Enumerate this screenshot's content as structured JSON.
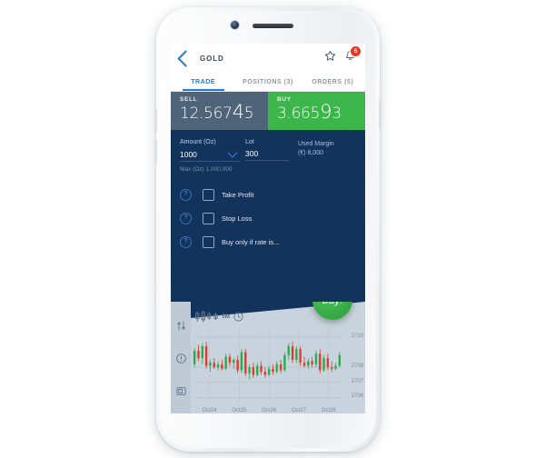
{
  "header": {
    "symbol": "GOLD",
    "back_icon": "back-chevron-icon",
    "star_icon": "star-outline-icon",
    "bell_icon": "bell-icon",
    "badge_count": "5"
  },
  "tabs": [
    {
      "label": "TRADE",
      "active": true
    },
    {
      "label": "POSITIONS (3)",
      "active": false
    },
    {
      "label": "ORDERS (5)",
      "active": false
    }
  ],
  "prices": {
    "sell": {
      "label": "SELL",
      "small_prefix": "12.567",
      "big_digits": "4",
      "small_suffix": "5",
      "color": "#4f6379"
    },
    "buy": {
      "label": "BUY",
      "small_prefix": "3.665",
      "big_digits": "9",
      "small_suffix": "3",
      "color": "#3cb54a"
    }
  },
  "form": {
    "amount_label": "Amount (Oz)",
    "amount_value": "1000",
    "lot_label": "Lot",
    "lot_value": "300",
    "margin_label": "Used Margin",
    "margin_value": "(€) 8,000",
    "max_note": "Max (Oz) 1,000,000",
    "options": [
      {
        "label": "Take Profit",
        "checked": false,
        "help": "?"
      },
      {
        "label": "Stop Loss",
        "checked": false,
        "help": "?"
      },
      {
        "label": "Buy only if rate is...",
        "checked": false,
        "help": "?"
      }
    ]
  },
  "buy_button": {
    "label": "buy!",
    "color": "#3aaf49"
  },
  "chart": {
    "timeframe": "5M",
    "rail_icons": [
      "swap-vertical-icon",
      "info-circle-icon",
      "report-icon"
    ],
    "type_icon": "candlestick-icon",
    "clock_icon": "clock-icon"
  },
  "chart_data": {
    "type": "bar",
    "chart_style": "candlestick",
    "title": "",
    "xlabel": "",
    "ylabel": "",
    "categories": [
      "Oct24",
      "Oct25",
      "Oct26",
      "Oct27",
      "Oct28"
    ],
    "x_tick_labels": [
      "Oct24",
      "Oct25",
      "Oct26",
      "Oct27",
      "Oct28"
    ],
    "y_tick_labels": [
      "2710",
      "2708",
      "2707",
      "2706"
    ],
    "ylim": [
      2705.6,
      2710.6
    ],
    "grid": true,
    "up_color": "#27ae4a",
    "down_color": "#e03a2f",
    "candles": [
      {
        "o": 2708.2,
        "h": 2709.3,
        "l": 2708.0,
        "c": 2709.1,
        "dir": "up"
      },
      {
        "o": 2709.1,
        "h": 2709.5,
        "l": 2708.4,
        "c": 2708.6,
        "dir": "down"
      },
      {
        "o": 2708.6,
        "h": 2709.6,
        "l": 2708.2,
        "c": 2709.4,
        "dir": "up"
      },
      {
        "o": 2709.4,
        "h": 2709.7,
        "l": 2707.9,
        "c": 2708.1,
        "dir": "down"
      },
      {
        "o": 2708.1,
        "h": 2708.5,
        "l": 2707.7,
        "c": 2708.3,
        "dir": "up"
      },
      {
        "o": 2708.3,
        "h": 2708.6,
        "l": 2707.9,
        "c": 2708.0,
        "dir": "down"
      },
      {
        "o": 2708.0,
        "h": 2708.4,
        "l": 2707.8,
        "c": 2708.2,
        "dir": "up"
      },
      {
        "o": 2708.2,
        "h": 2708.5,
        "l": 2707.8,
        "c": 2707.9,
        "dir": "down"
      },
      {
        "o": 2707.9,
        "h": 2708.9,
        "l": 2707.8,
        "c": 2708.7,
        "dir": "up"
      },
      {
        "o": 2708.7,
        "h": 2708.9,
        "l": 2708.1,
        "c": 2708.3,
        "dir": "down"
      },
      {
        "o": 2708.3,
        "h": 2708.6,
        "l": 2707.9,
        "c": 2708.5,
        "dir": "up"
      },
      {
        "o": 2708.5,
        "h": 2708.8,
        "l": 2707.6,
        "c": 2707.8,
        "dir": "down"
      },
      {
        "o": 2707.8,
        "h": 2709.2,
        "l": 2707.6,
        "c": 2709.0,
        "dir": "up"
      },
      {
        "o": 2709.0,
        "h": 2709.2,
        "l": 2707.4,
        "c": 2707.6,
        "dir": "down"
      },
      {
        "o": 2707.6,
        "h": 2708.2,
        "l": 2707.2,
        "c": 2708.0,
        "dir": "up"
      },
      {
        "o": 2708.0,
        "h": 2708.3,
        "l": 2707.3,
        "c": 2707.5,
        "dir": "down"
      },
      {
        "o": 2707.5,
        "h": 2708.3,
        "l": 2707.4,
        "c": 2708.1,
        "dir": "up"
      },
      {
        "o": 2708.1,
        "h": 2708.4,
        "l": 2707.5,
        "c": 2707.7,
        "dir": "down"
      },
      {
        "o": 2707.7,
        "h": 2708.0,
        "l": 2707.3,
        "c": 2707.5,
        "dir": "down"
      },
      {
        "o": 2707.5,
        "h": 2708.1,
        "l": 2707.4,
        "c": 2707.9,
        "dir": "up"
      },
      {
        "o": 2707.9,
        "h": 2708.2,
        "l": 2707.5,
        "c": 2707.7,
        "dir": "down"
      },
      {
        "o": 2707.7,
        "h": 2708.4,
        "l": 2707.6,
        "c": 2708.2,
        "dir": "up"
      },
      {
        "o": 2708.2,
        "h": 2708.5,
        "l": 2707.6,
        "c": 2707.8,
        "dir": "down"
      },
      {
        "o": 2707.8,
        "h": 2709.0,
        "l": 2707.7,
        "c": 2708.8,
        "dir": "up"
      },
      {
        "o": 2708.8,
        "h": 2709.6,
        "l": 2708.5,
        "c": 2709.4,
        "dir": "up"
      },
      {
        "o": 2709.4,
        "h": 2709.7,
        "l": 2708.3,
        "c": 2708.5,
        "dir": "down"
      },
      {
        "o": 2708.5,
        "h": 2709.4,
        "l": 2708.3,
        "c": 2709.2,
        "dir": "up"
      },
      {
        "o": 2709.2,
        "h": 2709.4,
        "l": 2708.1,
        "c": 2708.3,
        "dir": "down"
      },
      {
        "o": 2708.3,
        "h": 2708.7,
        "l": 2708.0,
        "c": 2708.1,
        "dir": "down"
      },
      {
        "o": 2708.1,
        "h": 2708.6,
        "l": 2707.9,
        "c": 2708.4,
        "dir": "up"
      },
      {
        "o": 2708.4,
        "h": 2708.7,
        "l": 2708.0,
        "c": 2708.2,
        "dir": "down"
      },
      {
        "o": 2708.2,
        "h": 2709.1,
        "l": 2708.0,
        "c": 2708.9,
        "dir": "up"
      },
      {
        "o": 2708.9,
        "h": 2709.2,
        "l": 2707.6,
        "c": 2707.8,
        "dir": "down"
      },
      {
        "o": 2707.8,
        "h": 2708.8,
        "l": 2707.7,
        "c": 2708.6,
        "dir": "up"
      },
      {
        "o": 2708.6,
        "h": 2708.9,
        "l": 2707.8,
        "c": 2708.0,
        "dir": "down"
      },
      {
        "o": 2708.0,
        "h": 2708.4,
        "l": 2707.7,
        "c": 2707.9,
        "dir": "down"
      },
      {
        "o": 2707.9,
        "h": 2708.3,
        "l": 2707.8,
        "c": 2708.1,
        "dir": "up"
      },
      {
        "o": 2708.1,
        "h": 2709.0,
        "l": 2708.0,
        "c": 2708.8,
        "dir": "up"
      }
    ]
  }
}
